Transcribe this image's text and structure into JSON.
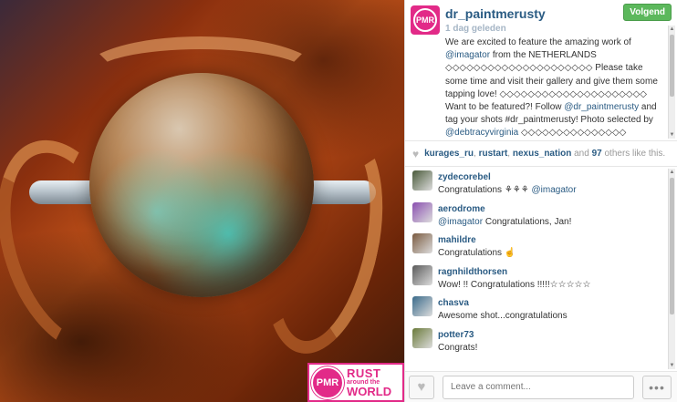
{
  "post": {
    "username": "dr_paintmerusty",
    "time": "1 dag geleden",
    "follow_label": "Volgend",
    "caption_parts": {
      "p1": "We are excited to feature the amazing work of ",
      "m1": "@imagator",
      "p2": " from the NETHERLANDS ◇◇◇◇◇◇◇◇◇◇◇◇◇◇◇◇◇◇◇◇◇ Please take some time and visit their gallery and give them some tapping love! ◇◇◇◇◇◇◇◇◇◇◇◇◇◇◇◇◇◇◇◇◇ Want to be featured?! Follow ",
      "m2": "@dr_paintmerusty",
      "p3": " and tag your shots #dr_paintmerusty! Photo selected by ",
      "m3": "@debtracyvirginia",
      "p4": " ◇◇◇◇◇◇◇◇◇◇◇◇◇◇◇"
    }
  },
  "avatar_text": "PMR",
  "logo": {
    "badge": "PMR",
    "line1": "RUST",
    "line2": "around the",
    "line3": "WORLD"
  },
  "likes": {
    "users": [
      "kurages_ru",
      "rustart",
      "nexus_nation"
    ],
    "sep": ", ",
    "and": " and ",
    "count": "97",
    "suffix": " others like this."
  },
  "comments": [
    {
      "user": "zydecorebel",
      "text_pre": "Congratulations ⚘⚘⚘ ",
      "mention": "@imagator",
      "text_post": "",
      "color": "#4a5a3a"
    },
    {
      "user": "aerodrome",
      "text_pre": "",
      "mention": "@imagator",
      "text_post": " Congratulations, Jan!",
      "color": "#8a4fb0"
    },
    {
      "user": "mahildre",
      "text_pre": "Congratulations ☝",
      "mention": "",
      "text_post": "",
      "color": "#7a5a40"
    },
    {
      "user": "ragnhildthorsen",
      "text_pre": "Wow! !! Congratulations !!!!!☆☆☆☆☆",
      "mention": "",
      "text_post": "",
      "color": "#5a5a5a"
    },
    {
      "user": "chasva",
      "text_pre": "Awesome shot...congratulations",
      "mention": "",
      "text_post": "",
      "color": "#3a6a8a"
    },
    {
      "user": "potter73",
      "text_pre": "Congrats!",
      "mention": "",
      "text_post": "",
      "color": "#6a7a3a"
    }
  ],
  "footer": {
    "comment_placeholder": "Leave a comment...",
    "more": "•••"
  },
  "colors": {
    "link": "#2a5b83",
    "follow": "#5cb85c",
    "brand": "#e22a88"
  }
}
